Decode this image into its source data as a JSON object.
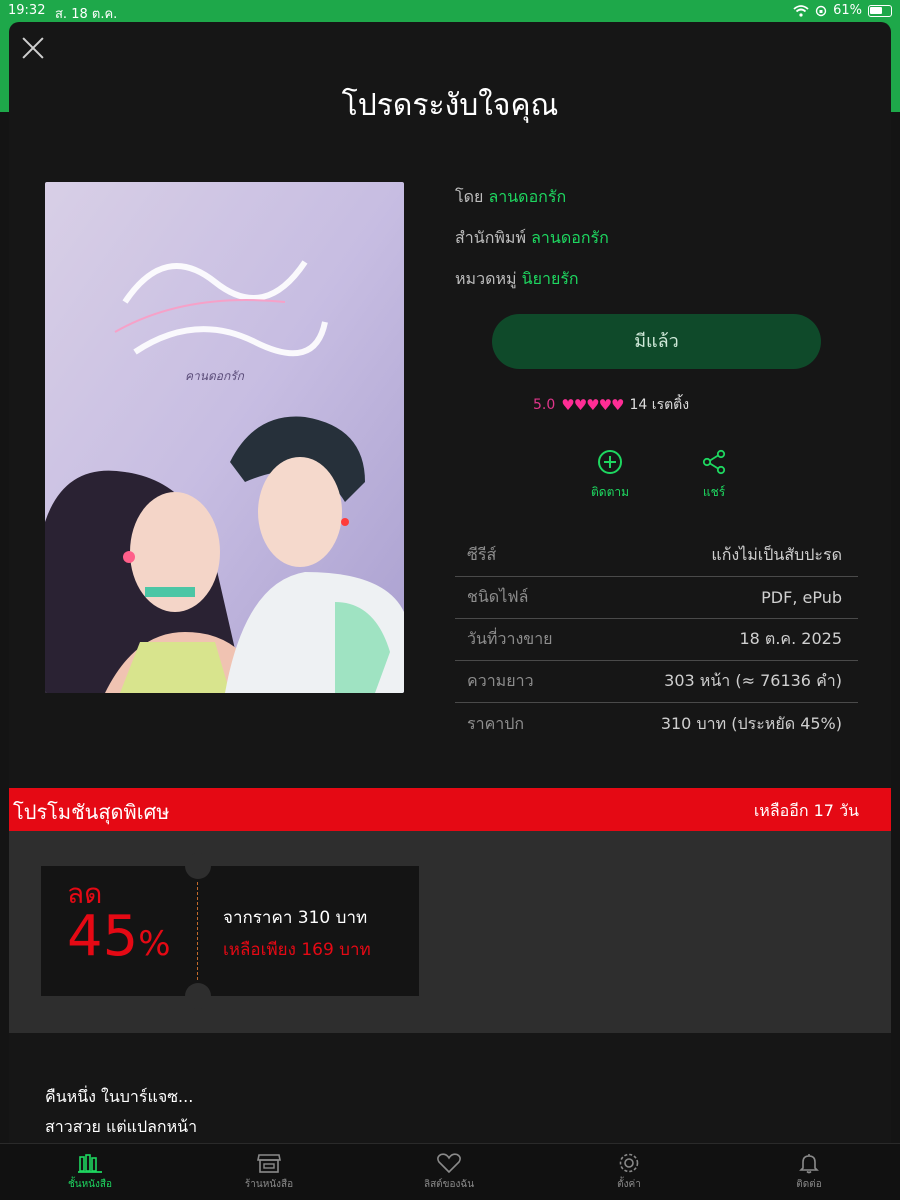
{
  "status": {
    "time": "19:32",
    "date": "ส. 18 ต.ค.",
    "battery": "61%"
  },
  "book": {
    "title": "โปรดระงับใจคุณ",
    "author_label": "โดย",
    "author": "ลานดอกรัก",
    "publisher_label": "สำนักพิมพ์",
    "publisher": "ลานดอกรัก",
    "category_label": "หมวดหมู่",
    "category": "นิยายรัก",
    "owned_button": "มีแล้ว",
    "rating_score": "5.0",
    "stars": "♥♥♥♥♥",
    "rating_count": "14 เรตติ้ง",
    "follow_label": "ติดตาม",
    "share_label": "แชร์",
    "cover_text": "คานดอกรัก"
  },
  "details": [
    {
      "key": "ซีรีส์",
      "value": "แก้งไม่เป็นสับปะรด"
    },
    {
      "key": "ชนิดไฟล์",
      "value": "PDF, ePub"
    },
    {
      "key": "วันที่วางขาย",
      "value": "18 ต.ค. 2025"
    },
    {
      "key": "ความยาว",
      "value": "303  หน้า (≈ 76136 คำ)"
    },
    {
      "key": "ราคาปก",
      "value": "310 บาท (ประหยัด 45%)"
    }
  ],
  "promo": {
    "banner_title": "โปรโมชันสุดพิเศษ",
    "days_left": "เหลืออีก 17 วัน",
    "discount_word": "ลด",
    "discount_value": "45",
    "discount_sign": "%",
    "from_price": "จากราคา 310 บาท",
    "now_price": "เหลือเพียง 169 บาท"
  },
  "description": {
    "line1": "คืนหนึ่ง ในบาร์แจซ...",
    "line2": "สาวสวย แต่แปลกหน้า"
  },
  "tabs": [
    {
      "label": "ชั้นหนังสือ",
      "icon": "bookshelf-icon",
      "active": true
    },
    {
      "label": "ร้านหนังสือ",
      "icon": "store-icon",
      "active": false
    },
    {
      "label": "ลิสต์ของฉัน",
      "icon": "heart-icon",
      "active": false
    },
    {
      "label": "ตั้งค่า",
      "icon": "gear-icon",
      "active": false
    },
    {
      "label": "ติดต่อ",
      "icon": "bell-icon",
      "active": false
    }
  ],
  "colors": {
    "accent_green": "#1ed760",
    "promo_red": "#e50914",
    "star_pink": "#ff2d95"
  }
}
